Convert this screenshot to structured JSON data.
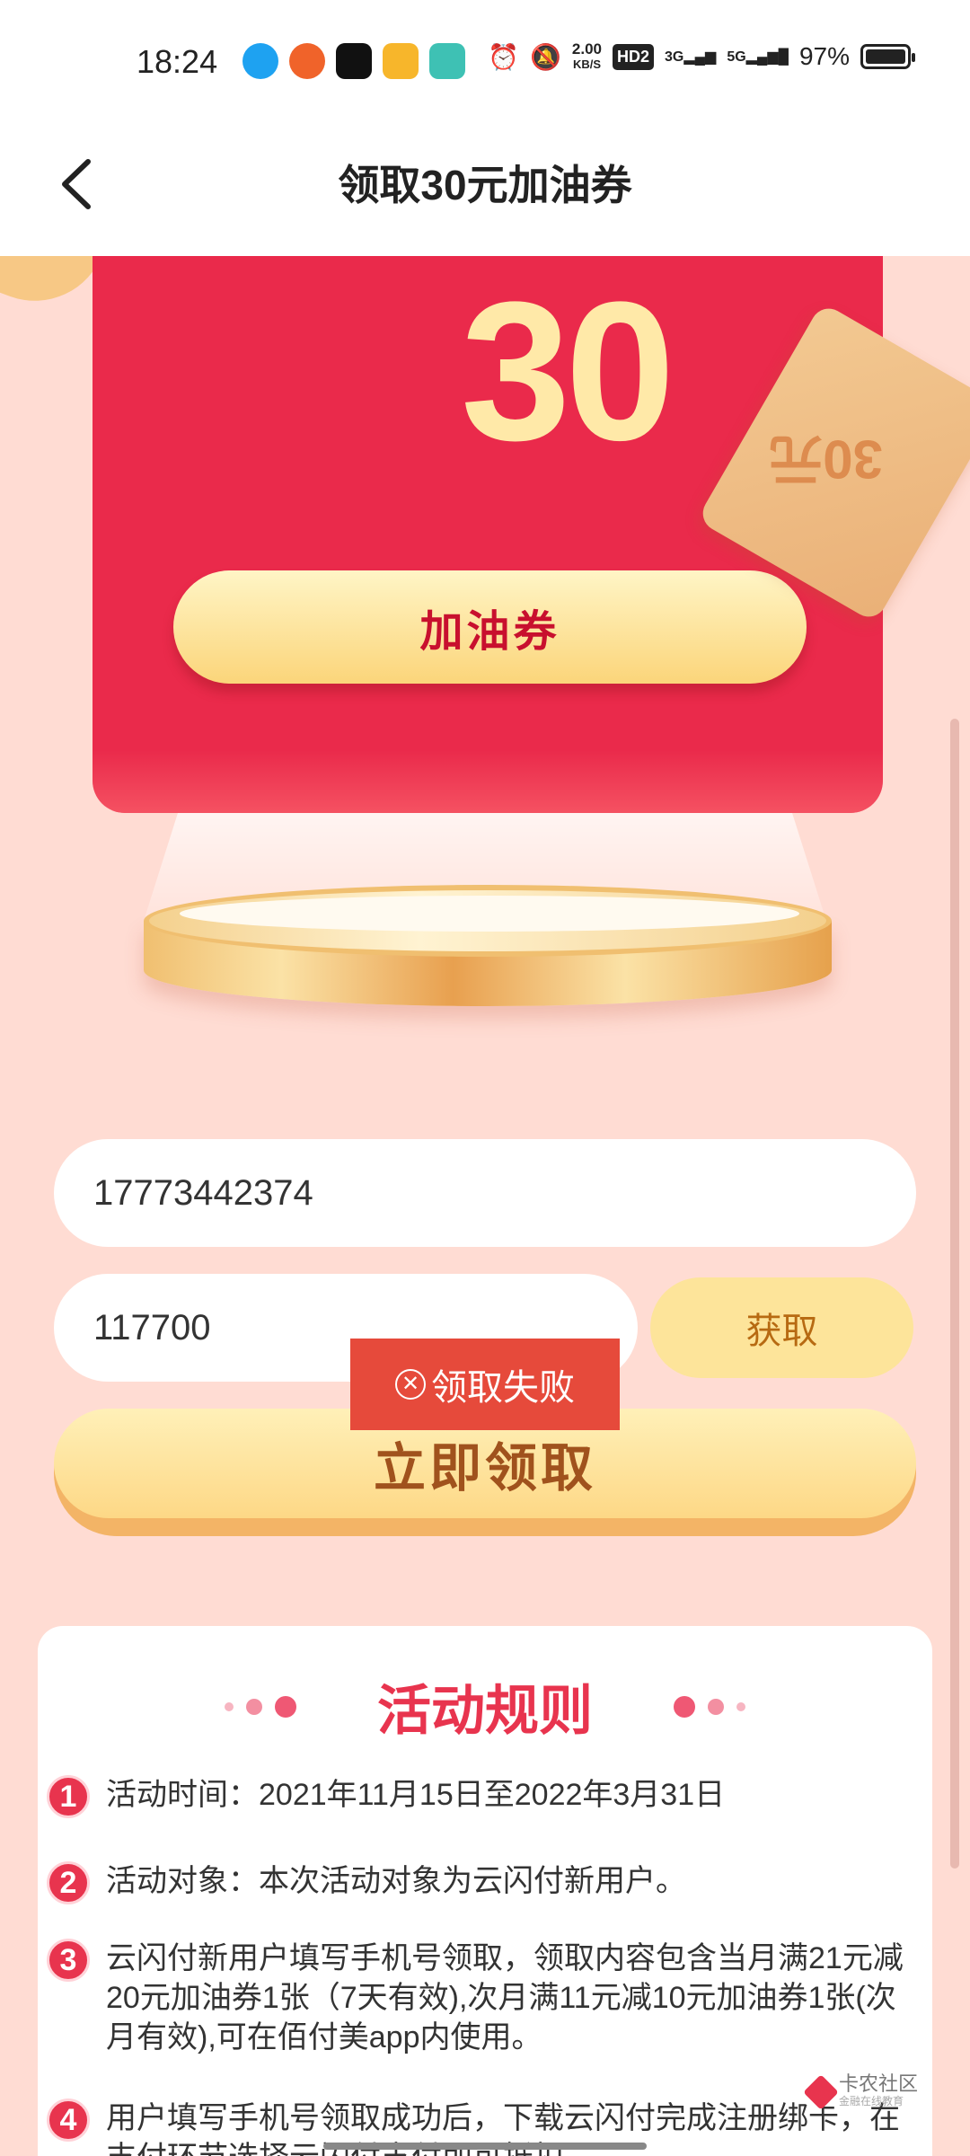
{
  "status_bar": {
    "time": "18:24",
    "net_speed_value": "2.00",
    "net_speed_unit": "KB/S",
    "hd_badge": "HD2",
    "signal_3g": "3G",
    "signal_5g": "5G",
    "battery": "97%",
    "app_icons": [
      {
        "name": "qq-icon",
        "color": "#1ea2f1"
      },
      {
        "name": "game-icon",
        "color": "#f0632a"
      },
      {
        "name": "app-o-icon",
        "color": "#111111"
      },
      {
        "name": "weibo-icon",
        "color": "#f7b62b"
      },
      {
        "name": "chat-bubble-icon",
        "color": "#3ec1b4"
      }
    ]
  },
  "nav": {
    "title": "领取30元加油券"
  },
  "hero": {
    "amount": "30",
    "unit": "元",
    "coupon_label": "加油券",
    "ticket_text": "30元"
  },
  "form": {
    "phone_value": "17773442374",
    "code_value": "117700",
    "get_code_label": "获取",
    "submit_label": "立即领取"
  },
  "toast": {
    "message": "领取失败"
  },
  "rules": {
    "title": "活动规则",
    "items": [
      {
        "num": "1",
        "text": "活动时间：2021年11月15日至2022年3月31日"
      },
      {
        "num": "2",
        "text": "活动对象：本次活动对象为云闪付新用户。"
      },
      {
        "num": "3",
        "text": "云闪付新用户填写手机号领取，领取内容包含当月满21元减20元加油券1张（7天有效),次月满11元减10元加油券1张(次月有效),可在佰付美app内使用。"
      },
      {
        "num": "4",
        "text": "用户填写手机号领取成功后，下载云闪付完成注册绑卡，在支付环节选择云闪付支付即可抵扣。"
      }
    ]
  },
  "watermark": {
    "name": "卡农社区",
    "sub": "金融在线教育"
  },
  "colors": {
    "red": "#ea2a4b",
    "gold": "#ffe9a8",
    "background": "#ffdcd3",
    "toast": "#e64a3b",
    "rule_accent": "#e8344e"
  }
}
